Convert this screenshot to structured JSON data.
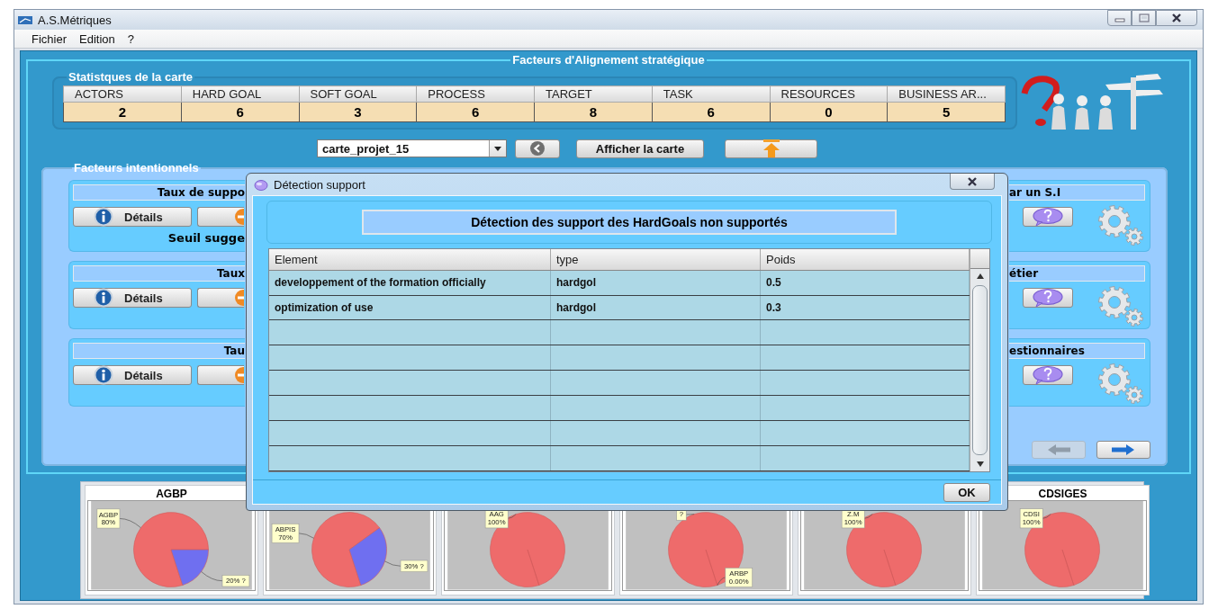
{
  "window": {
    "title": "A.S.Métriques"
  },
  "menu": [
    {
      "label": "Fichier"
    },
    {
      "label": "Edition"
    },
    {
      "label": "?"
    }
  ],
  "main_title": "Facteurs d'Alignement stratégique",
  "stats": {
    "title": "Statistques de la carte",
    "columns": [
      "ACTORS",
      "HARD GOAL",
      "SOFT GOAL",
      "PROCESS",
      "TARGET",
      "TASK",
      "RESOURCES",
      "BUSINESS AR..."
    ],
    "values": [
      "2",
      "6",
      "3",
      "6",
      "8",
      "6",
      "0",
      "5"
    ]
  },
  "toolbar": {
    "map_select": {
      "value": "carte_projet_15"
    },
    "show_button": "Afficher la carte"
  },
  "intentional": {
    "title": "Facteurs intentionnels",
    "left_panels": [
      {
        "header": "Taux de suppo",
        "details": "Détails",
        "note": "Seuil sugge"
      },
      {
        "header": "Taux",
        "details": "Détails"
      },
      {
        "header": "Tau",
        "details": "Détails"
      }
    ],
    "right_panels": [
      {
        "header": "ar un S.I"
      },
      {
        "header": "étier"
      },
      {
        "header": "estionnaires"
      }
    ],
    "nav": [
      {
        "kind": "prev",
        "disabled": true
      },
      {
        "kind": "next",
        "disabled": false
      }
    ]
  },
  "dialog": {
    "title": "Détection support",
    "heading": "Détection des support des HardGoals non supportés",
    "table": {
      "columns": [
        "Element",
        "type",
        "Poids"
      ],
      "rows": [
        [
          "developpement of the formation officially",
          "hardgol",
          "0.5"
        ],
        [
          "optimization of use",
          "hardgol",
          "0.3"
        ]
      ]
    },
    "ok": "OK"
  },
  "charts": [
    {
      "chart_data": {
        "type": "pie",
        "title": "AGBP",
        "categories": [
          "AGBP",
          "?"
        ],
        "values": [
          80,
          20
        ],
        "value_labels": [
          "80%",
          "20%"
        ]
      }
    },
    {
      "chart_data": {
        "type": "pie",
        "categories": [
          "ABPIS",
          "?"
        ],
        "values": [
          70,
          30
        ],
        "value_labels": [
          "70%",
          "30%"
        ]
      }
    },
    {
      "chart_data": {
        "type": "pie",
        "categories": [
          "AAG"
        ],
        "values": [
          100
        ],
        "value_labels": [
          "100%"
        ]
      }
    },
    {
      "chart_data": {
        "type": "pie",
        "categories": [
          "?",
          "ARBP"
        ],
        "values": [
          100,
          0
        ],
        "value_labels": [
          null,
          "0.00%"
        ]
      }
    },
    {
      "chart_data": {
        "type": "pie",
        "categories": [
          "Z.M"
        ],
        "values": [
          100
        ],
        "value_labels": [
          "100%"
        ]
      }
    },
    {
      "chart_data": {
        "type": "pie",
        "title": "CDSIGES",
        "categories": [
          "CDSI"
        ],
        "values": [
          100
        ],
        "value_labels": [
          "100%"
        ]
      }
    }
  ]
}
